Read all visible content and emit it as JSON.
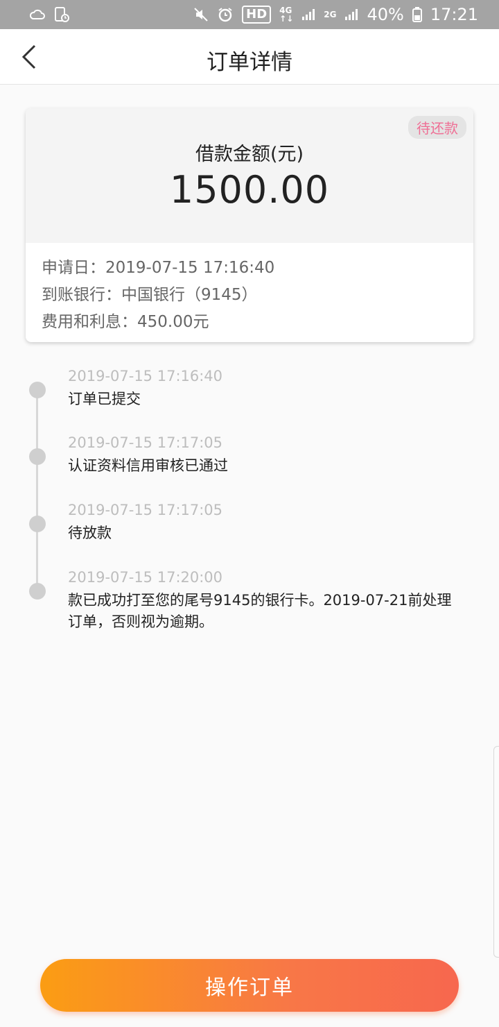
{
  "status_bar": {
    "hd": "HD",
    "net1": "4G",
    "net2": "2G",
    "battery": "40%",
    "time": "17:21"
  },
  "header": {
    "title": "订单详情"
  },
  "loan_card": {
    "status_badge": "待还款",
    "amount_label": "借款金额(元)",
    "amount_value": "1500.00",
    "info": [
      "申请日：2019-07-15 17:16:40",
      "到账银行：中国银行（9145）",
      "费用和利息：450.00元"
    ]
  },
  "timeline": [
    {
      "time": "2019-07-15 17:16:40",
      "desc": "订单已提交"
    },
    {
      "time": "2019-07-15 17:17:05",
      "desc": "认证资料信用审核已通过"
    },
    {
      "time": "2019-07-15 17:17:05",
      "desc": "待放款"
    },
    {
      "time": "2019-07-15 17:20:00",
      "desc": "款已成功打至您的尾号9145的银行卡。2019-07-21前处理订单，否则视为逾期。"
    }
  ],
  "action_button": {
    "label": "操作订单"
  },
  "colors": {
    "badge_text": "#ef6f95",
    "button_start": "#fb9d13",
    "button_end": "#f7674e",
    "status_bar_bg": "#a4a4a4"
  },
  "icons": [
    "weather-icon",
    "screen-record-icon",
    "mute-icon",
    "alarm-icon",
    "signal-icon",
    "battery-icon",
    "back-chevron-icon"
  ]
}
